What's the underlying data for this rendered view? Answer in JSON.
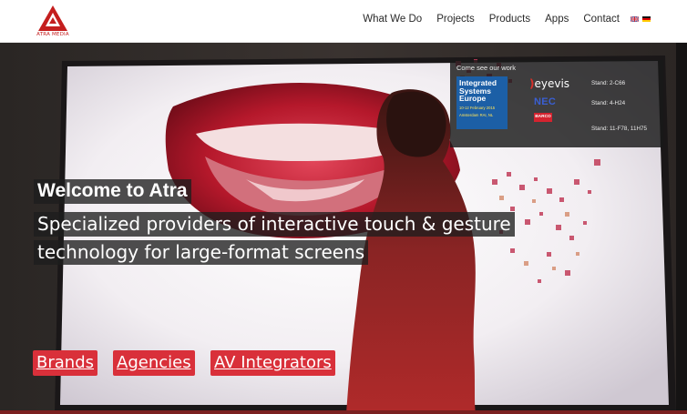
{
  "header": {
    "logo_text": "ATRA MEDIA",
    "nav": [
      "What We Do",
      "Projects",
      "Products",
      "Apps",
      "Contact"
    ],
    "languages": [
      "English flag",
      "German flag"
    ]
  },
  "hero": {
    "welcome": "Welcome to Atra",
    "tagline_line1": "Specialized providers of interactive touch & gesture",
    "tagline_line2": "technology for large-format screens",
    "buttons": [
      "Brands",
      "Agencies",
      "AV Integrators"
    ]
  },
  "stand_box": {
    "title": "Come see our work",
    "ise_line1": "Integrated",
    "ise_line2": "Systems",
    "ise_line3": "Europe",
    "ise_dates": "10-12 February 2015",
    "ise_place": "Amsterdam RAI, NL",
    "brand_eyevis": "eyevis",
    "brand_nec": "NEC",
    "brand_barco": "BARCO",
    "stand_eyevis": "Stand: 2-C66",
    "stand_nec": "Stand: 4-H24",
    "stand_barco": "Stand: 11-F78, 11H75"
  },
  "colors": {
    "accent": "#d9303a",
    "logo_red": "#c41e1e",
    "ise_blue": "#1c5fa6"
  }
}
